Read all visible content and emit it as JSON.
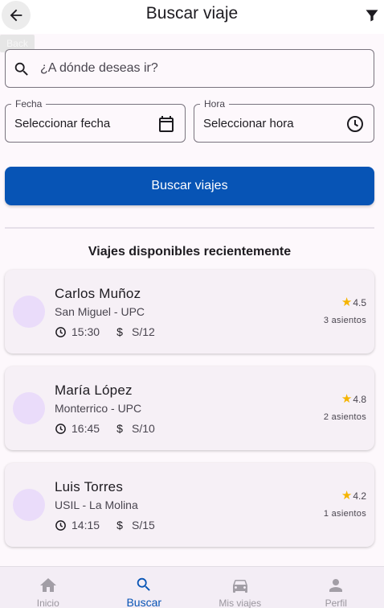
{
  "header": {
    "title": "Buscar viaje",
    "back_tooltip": "Back",
    "back_icon": "arrow-left-icon",
    "filter_icon": "filter-icon"
  },
  "search": {
    "placeholder": "¿A dónde deseas ir?",
    "value": ""
  },
  "date_field": {
    "label": "Fecha",
    "value": "Seleccionar fecha"
  },
  "time_field": {
    "label": "Hora",
    "value": "Seleccionar hora"
  },
  "search_button": {
    "label": "Buscar viajes"
  },
  "section_title": "Viajes disponibles recientemente",
  "trips": [
    {
      "name": "Carlos Muñoz",
      "route": "San Miguel - UPC",
      "time": "15:30",
      "price": "S/12",
      "rating": "4.5",
      "seats": "3 asientos"
    },
    {
      "name": "María López",
      "route": "Monterrico - UPC",
      "time": "16:45",
      "price": "S/10",
      "rating": "4.8",
      "seats": "2 asientos"
    },
    {
      "name": "Luis Torres",
      "route": "USIL - La Molina",
      "time": "14:15",
      "price": "S/15",
      "rating": "4.2",
      "seats": "1 asientos"
    }
  ],
  "currency_symbol": "$",
  "bottom_nav": [
    {
      "label": "Inicio",
      "icon": "home-icon"
    },
    {
      "label": "Buscar",
      "icon": "search-icon",
      "active": true
    },
    {
      "label": "Mis viajes",
      "icon": "car-icon"
    },
    {
      "label": "Perfil",
      "icon": "person-icon"
    }
  ],
  "colors": {
    "primary": "#0754b5",
    "background": "#fdf8fc",
    "card": "#f6f0f6",
    "avatar": "#eadcfa",
    "star": "#f5b400"
  }
}
